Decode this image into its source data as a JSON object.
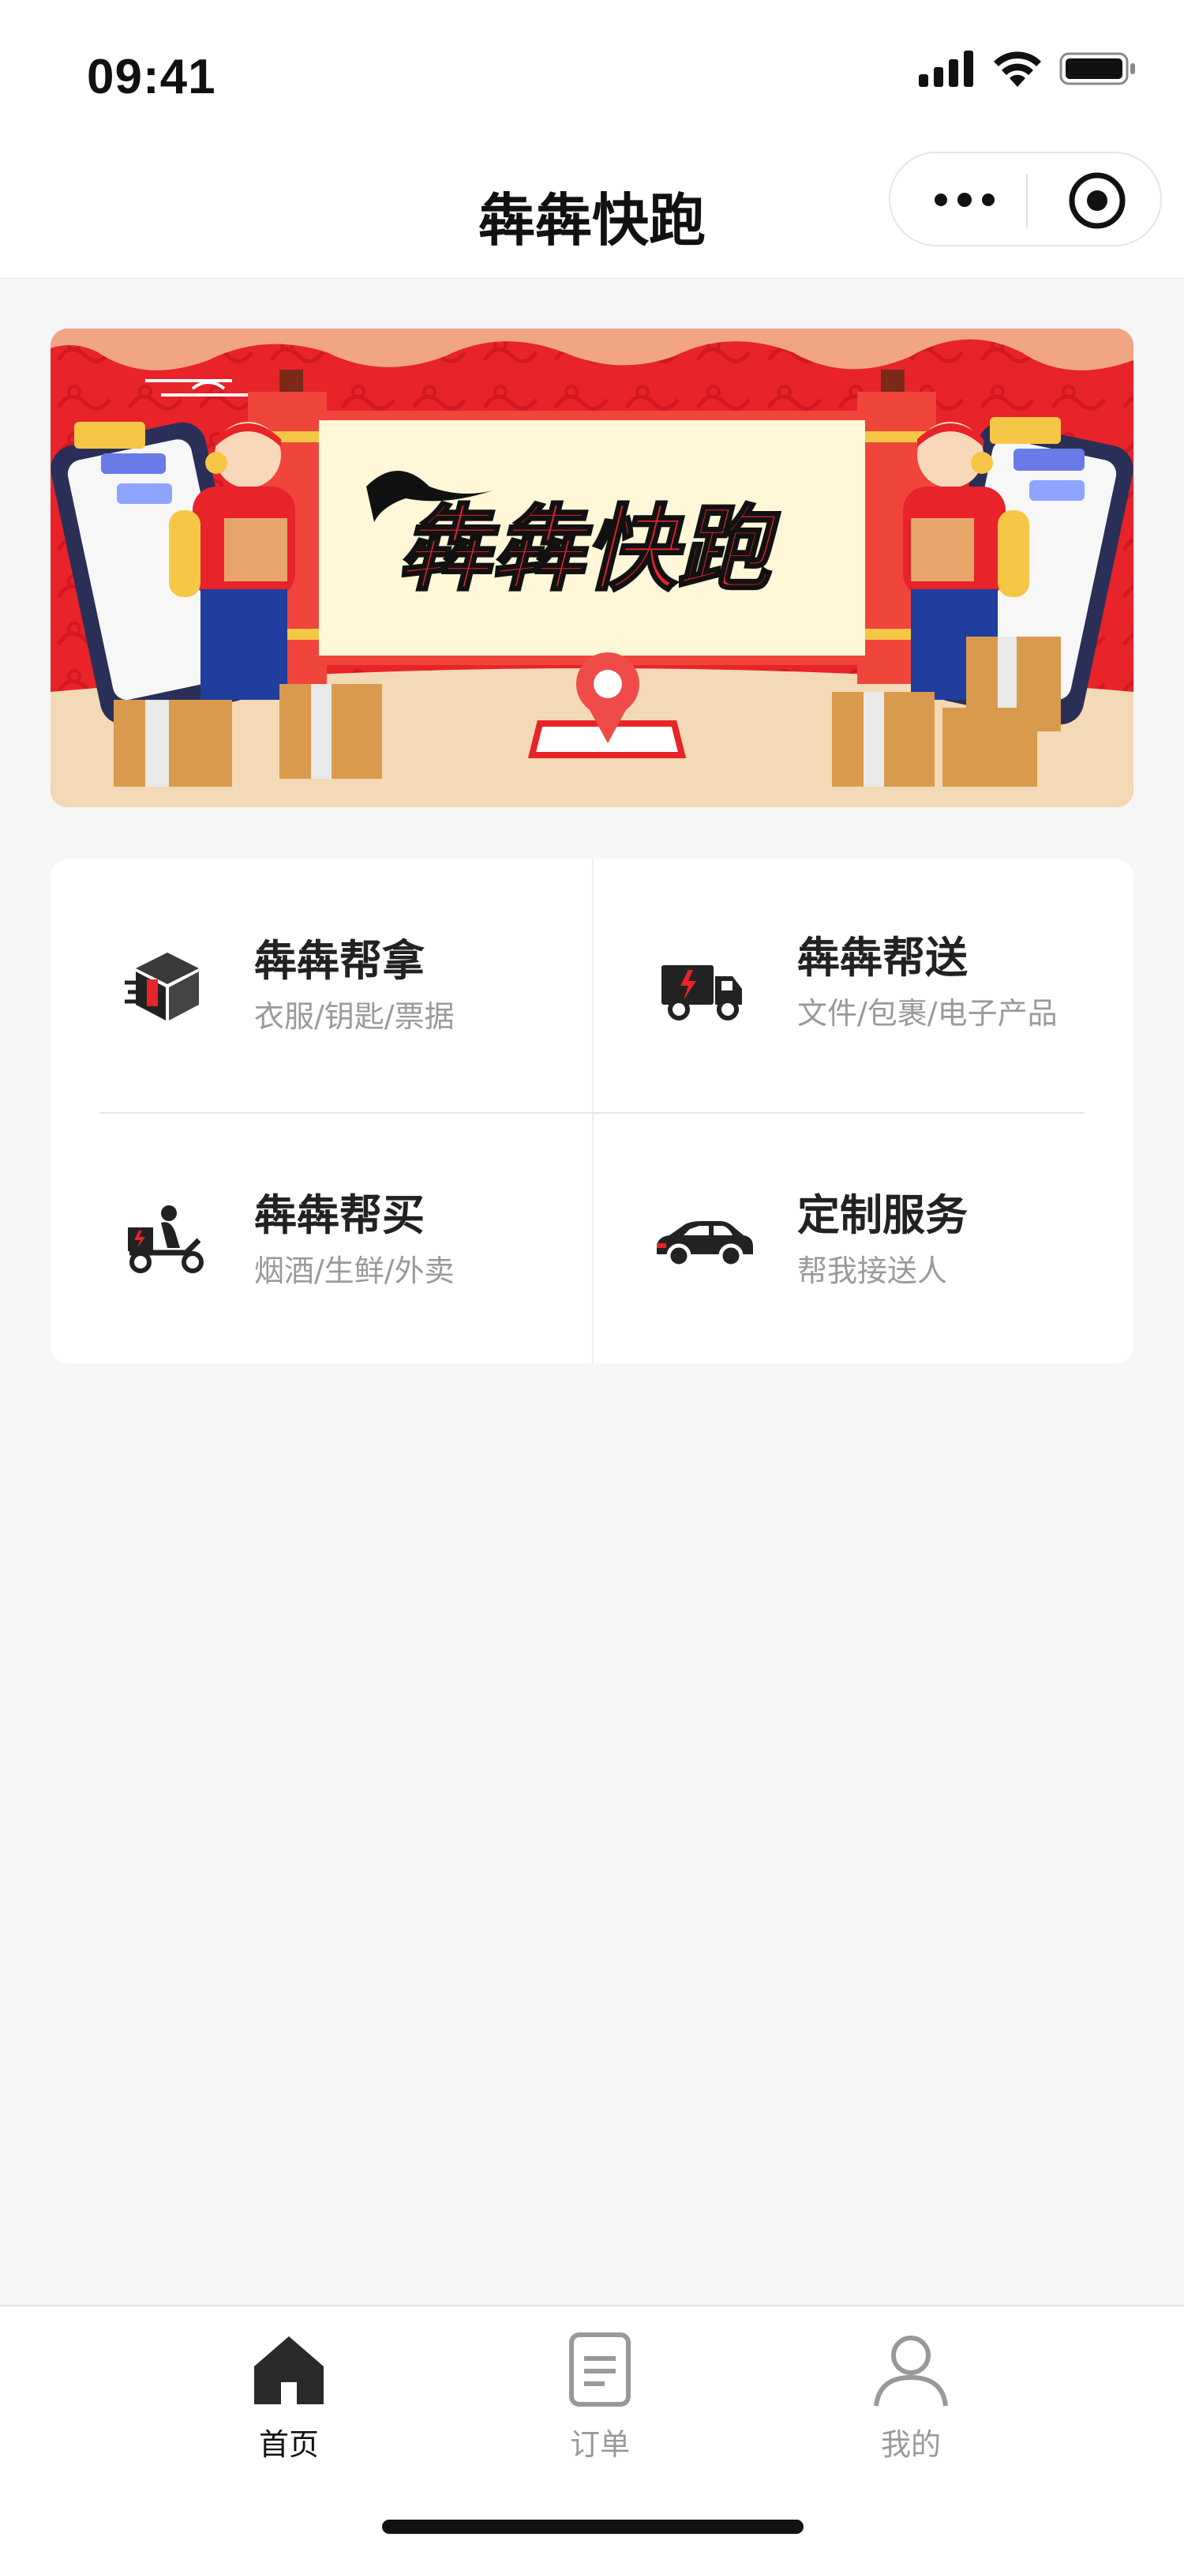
{
  "status_bar": {
    "time": "09:41"
  },
  "nav": {
    "title": "犇犇快跑"
  },
  "banner": {
    "logo_text": "犇犇快跑"
  },
  "services": [
    {
      "title": "犇犇帮拿",
      "subtitle": "衣服/钥匙/票据",
      "icon": "package-box-icon"
    },
    {
      "title": "犇犇帮送",
      "subtitle": "文件/包裹/电子产品",
      "icon": "delivery-truck-icon"
    },
    {
      "title": "犇犇帮买",
      "subtitle": "烟酒/生鲜/外卖",
      "icon": "scooter-courier-icon"
    },
    {
      "title": "定制服务",
      "subtitle": "帮我接送人",
      "icon": "car-icon"
    }
  ],
  "tabs": [
    {
      "label": "首页",
      "icon": "home-icon",
      "active": true
    },
    {
      "label": "订单",
      "icon": "order-document-icon",
      "active": false
    },
    {
      "label": "我的",
      "icon": "user-profile-icon",
      "active": false
    }
  ],
  "colors": {
    "brand_red": "#e8232a",
    "accent_yellow": "#f3c845",
    "text_dark": "#222222",
    "text_gray": "#9a9a9a"
  }
}
